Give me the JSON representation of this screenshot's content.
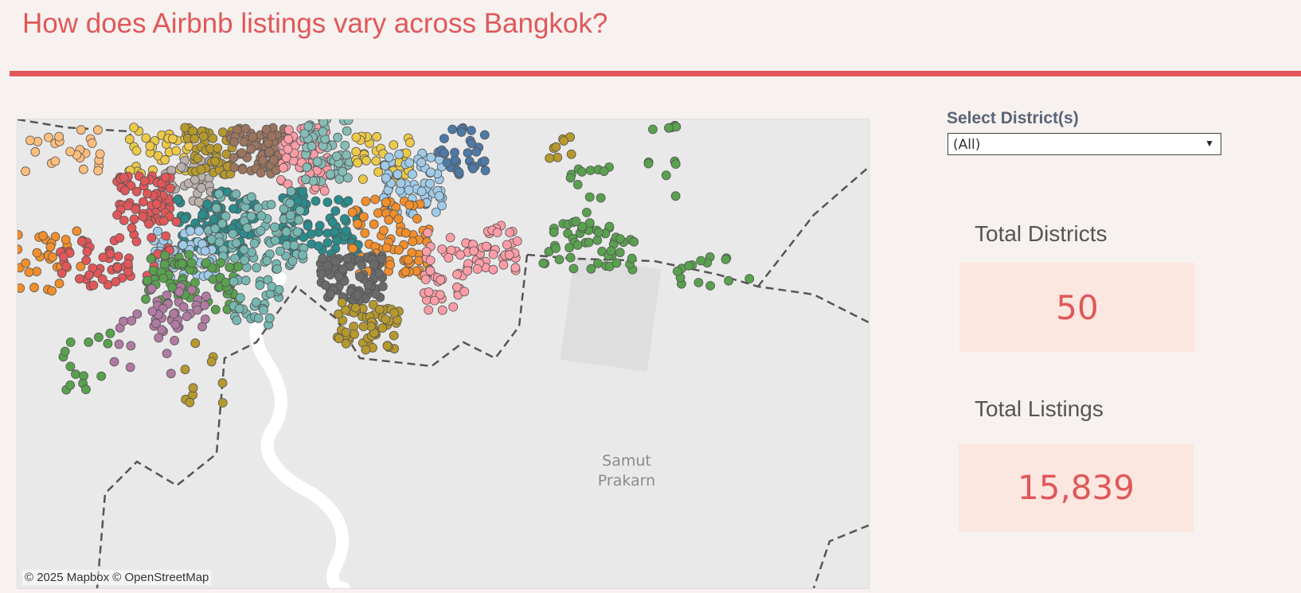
{
  "page": {
    "title": "How does Airbnb listings vary across Bangkok?"
  },
  "map": {
    "attribution": "© 2025 Mapbox  © OpenStreetMap",
    "place_label": "Samut\nPrakarn",
    "icons": [
      "map-dots"
    ]
  },
  "filter": {
    "label": "Select District(s)",
    "value": "(All)"
  },
  "kpis": {
    "districts": {
      "label": "Total Districts",
      "value": "50"
    },
    "listings": {
      "label": "Total Listings",
      "value": "15,839"
    }
  },
  "colors": {
    "accent": "#e15759",
    "kpi_bg": "#fbe7e0",
    "page_bg": "#f7f2ef",
    "palette": [
      "#4e79a7",
      "#f28e2b",
      "#e15759",
      "#76b7b2",
      "#59a14f",
      "#edc948",
      "#b07aa1",
      "#ff9da7",
      "#9c755f",
      "#bab0ac",
      "#2a8c8c",
      "#a0cbe8",
      "#8cd17d",
      "#b6992d",
      "#d4a6c8",
      "#f1ce63",
      "#d37295",
      "#6a6a6a",
      "#86bcb6",
      "#ffbe7d"
    ]
  }
}
